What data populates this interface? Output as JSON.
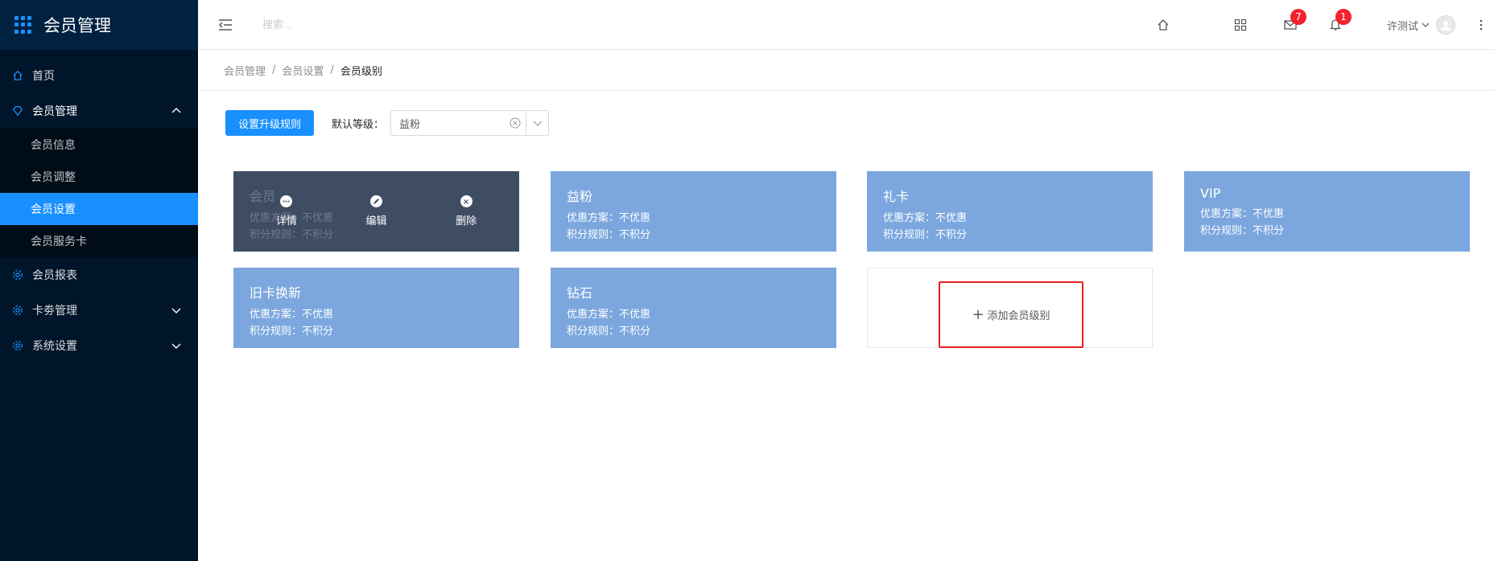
{
  "brand": {
    "title": "会员管理"
  },
  "sidebar": {
    "items": [
      {
        "label": "首页"
      },
      {
        "label": "会员管理"
      },
      {
        "label": "会员报表"
      },
      {
        "label": "卡劵管理"
      },
      {
        "label": "系统设置"
      }
    ],
    "submenu": [
      {
        "label": "会员信息"
      },
      {
        "label": "会员调整"
      },
      {
        "label": "会员设置"
      },
      {
        "label": "会员服务卡"
      }
    ]
  },
  "header": {
    "search_placeholder": "搜索...",
    "mail_badge": "7",
    "bell_badge": "1",
    "username": "许测试"
  },
  "breadcrumb": {
    "items": [
      "会员管理",
      "会员设置",
      "会员级别"
    ],
    "separator": "/"
  },
  "toolbar": {
    "upgrade_button": "设置升级规则",
    "default_level_label": "默认等级：",
    "default_level_value": "益粉"
  },
  "cards": [
    {
      "title": "会员",
      "discount": "优惠方案：不优惠",
      "points": "积分规则：不积分"
    },
    {
      "title": "益粉",
      "discount": "优惠方案：不优惠",
      "points": "积分规则：不积分"
    },
    {
      "title": "礼卡",
      "discount": "优惠方案：不优惠",
      "points": "积分规则：不积分"
    },
    {
      "title": "VIP",
      "discount": "优惠方案：不优惠",
      "points": "积分规则：不积分"
    },
    {
      "title": "旧卡换新",
      "discount": "优惠方案：不优惠",
      "points": "积分规则：不积分"
    },
    {
      "title": "钻石",
      "discount": "优惠方案：不优惠",
      "points": "积分规则：不积分"
    }
  ],
  "card_overlay": {
    "detail": "详情",
    "edit": "编辑",
    "delete": "删除"
  },
  "add_card": {
    "label": "添加会员级别"
  },
  "colors": {
    "sidebar_bg": "#001529",
    "accent": "#1890ff",
    "card_bg": "#7ba7de",
    "highlight_border": "#e52222"
  }
}
